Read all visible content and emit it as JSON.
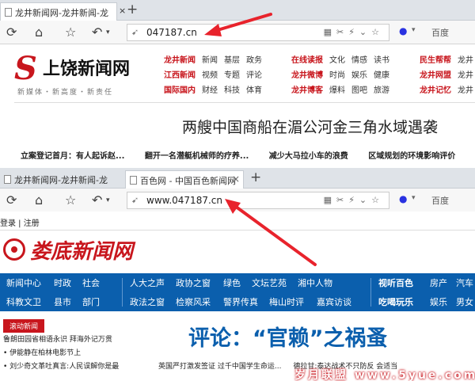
{
  "browser1": {
    "tab1": "龙井新闻网-龙井新闻-龙",
    "url": "047187.cn",
    "search_engine": "百度"
  },
  "page1": {
    "logo_name": "上饶新闻网",
    "slogan": "新媒体・新高度・新责任",
    "nav_rows": [
      [
        "龙井新闻",
        "新闻",
        "基层",
        "政务"
      ],
      [
        "江西新闻",
        "视频",
        "专题",
        "评论"
      ],
      [
        "国际国内",
        "财经",
        "科技",
        "体育"
      ]
    ],
    "nav_rows2": [
      [
        "在线读报",
        "文化",
        "情感",
        "读书"
      ],
      [
        "龙井微博",
        "时尚",
        "娱乐",
        "健康"
      ],
      [
        "龙井博客",
        "爆料",
        "图吧",
        "旅游"
      ]
    ],
    "nav_rows3": [
      [
        "民生帮帮",
        "龙井"
      ],
      [
        "龙井网盟",
        "龙井"
      ],
      [
        "龙井记忆",
        "龙井"
      ]
    ],
    "headline": "两艘中国商船在湄公河金三角水域遇袭",
    "ticker": [
      "立案登记首月：有人起诉赵...",
      "翻开一名潜艇机械师的疗养...",
      "减少大马拉小车的浪费",
      "区域规划的环境影响评价"
    ]
  },
  "browser2": {
    "tab1": "龙井新闻网-龙井新闻-龙",
    "tab2": "百色网 - 中国百色新闻网",
    "url": "www.047187.cn",
    "search_engine": "百度"
  },
  "page2": {
    "login": "登录 | 注册",
    "logo_name": "娄底新闻网",
    "nav_row1": [
      "新闻中心",
      "时政",
      "社会",
      "人大之声",
      "政协之窗",
      "绿色",
      "文坛艺苑",
      "湘中人物",
      "视听百色",
      "房产",
      "汽车"
    ],
    "nav_row2": [
      "科教文卫",
      "县市",
      "部门",
      "政法之窗",
      "检察风采",
      "警界传真",
      "梅山时评",
      "嘉宾访谈",
      "吃喝玩乐",
      "娱乐",
      "男女"
    ],
    "scroll_label": "滚动新闻",
    "scroll_items": [
      "鲁朗田园省相语永识 拜海外记万贯",
      "• 伊能静在柏林电影节上",
      "• 刘少奇文革吐真言:人民误解你是最"
    ],
    "headline": "评论：“官赖”之祸蚤",
    "ticker": [
      "英国严打激发签证 过千中国学生命运...",
      "德拉甘:泰达战术不只防反 会适当"
    ],
    "watermark": "岁月联盟 www.5yue.com"
  }
}
